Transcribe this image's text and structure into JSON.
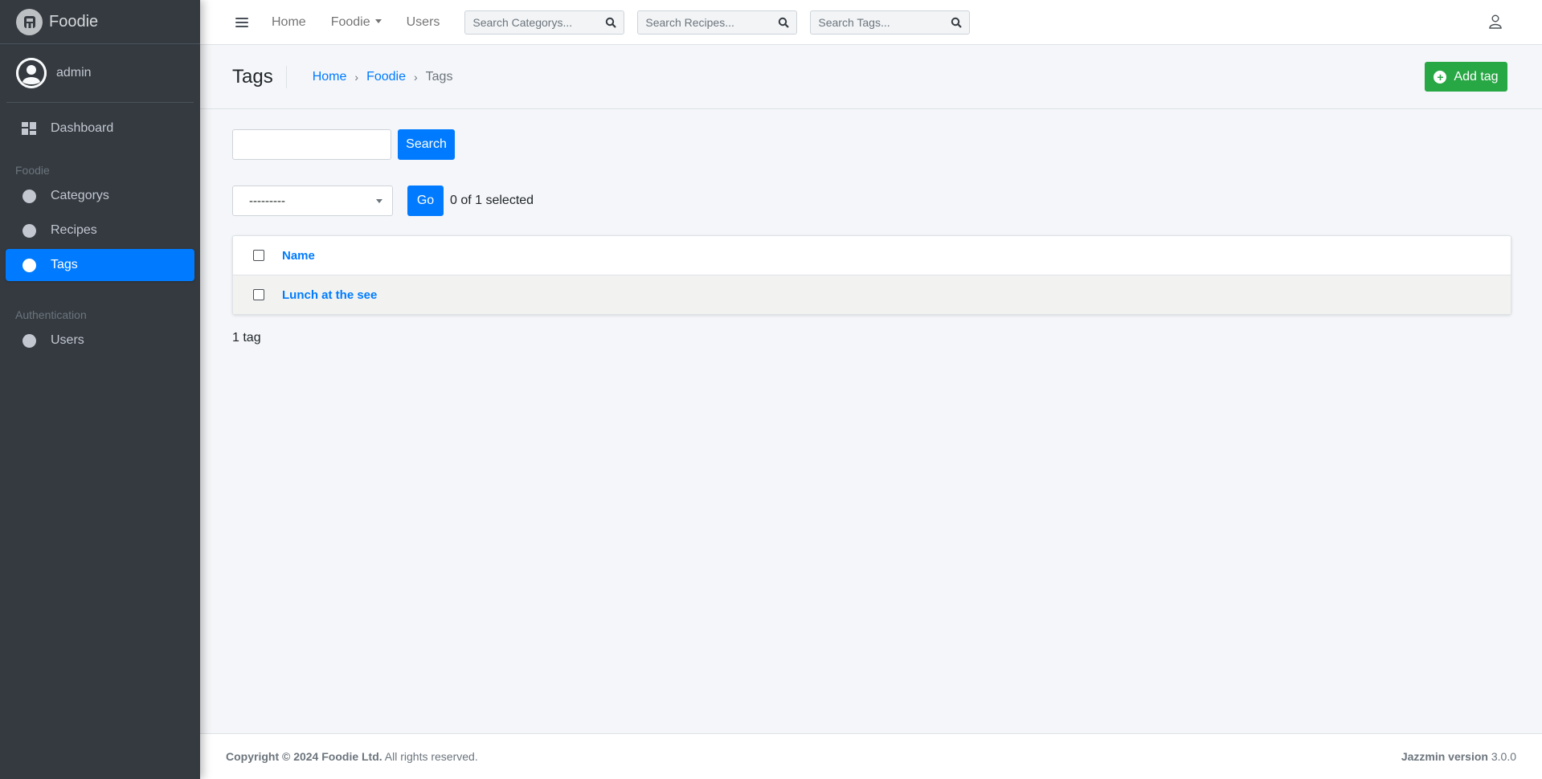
{
  "brand": {
    "name": "Foodie"
  },
  "user": {
    "name": "admin"
  },
  "sidebar": {
    "dashboard": "Dashboard",
    "section_foodie": "Foodie",
    "items_foodie": [
      "Categorys",
      "Recipes",
      "Tags"
    ],
    "section_auth": "Authentication",
    "items_auth": [
      "Users"
    ],
    "active": "Tags"
  },
  "topbar": {
    "links": [
      "Home",
      "Foodie",
      "Users"
    ],
    "search_categorys": "Search Categorys...",
    "search_recipes": "Search Recipes...",
    "search_tags": "Search Tags..."
  },
  "header": {
    "title": "Tags",
    "breadcrumb": [
      "Home",
      "Foodie",
      "Tags"
    ],
    "add_button": "Add tag"
  },
  "main": {
    "search_button": "Search",
    "action_select_value": "---------",
    "go_button": "Go",
    "selected_text": "0 of 1 selected",
    "table": {
      "column_name": "Name",
      "rows": [
        "Lunch at the see"
      ]
    },
    "paginator": "1 tag"
  },
  "footer": {
    "copyright_bold": "Copyright © 2024 Foodie Ltd.",
    "copyright_rest": " All rights reserved.",
    "version_label": "Jazzmin version",
    "version_value": " 3.0.0"
  },
  "colors": {
    "sidebar_bg": "#343a40",
    "accent": "#007bff",
    "add_button": "#28a745",
    "content_bg": "#f4f6f9"
  }
}
